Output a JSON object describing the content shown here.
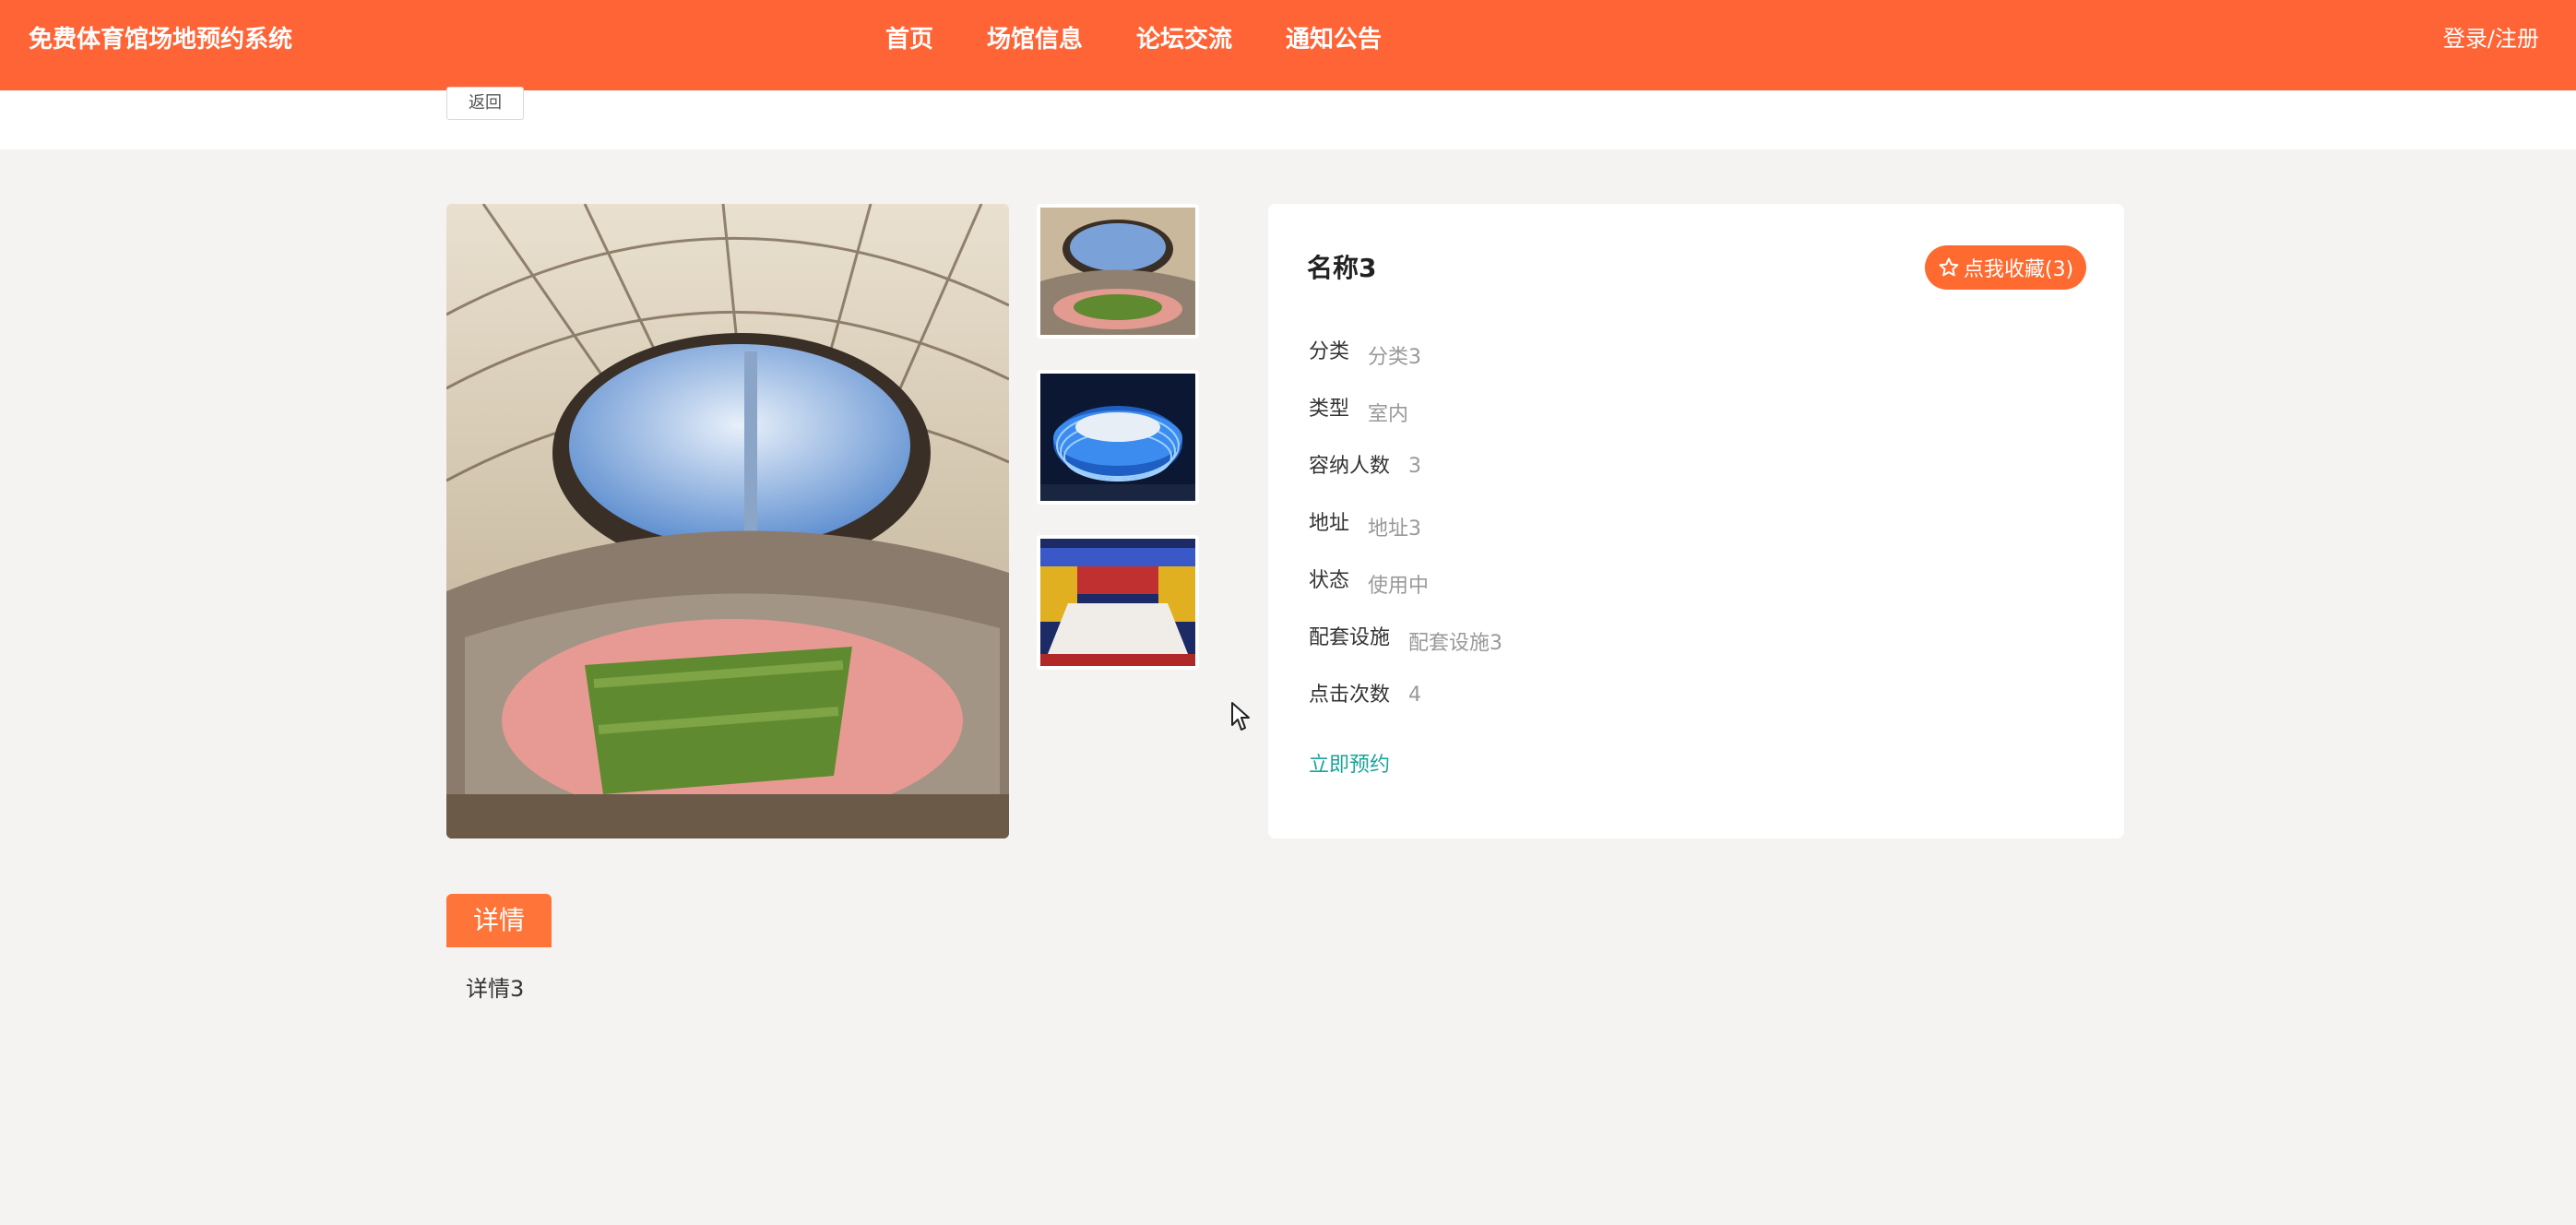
{
  "header": {
    "site_title": "免费体育馆场地预约系统",
    "nav": [
      "首页",
      "场馆信息",
      "论坛交流",
      "通知公告"
    ],
    "login": "登录/注册"
  },
  "back_label": "返回",
  "venue": {
    "name": "名称3",
    "favorite_label": "点我收藏(3)",
    "fields": [
      {
        "label": "分类",
        "value": "分类3"
      },
      {
        "label": "类型",
        "value": "室内"
      },
      {
        "label": "容纳人数",
        "value": "3"
      },
      {
        "label": "地址",
        "value": "地址3"
      },
      {
        "label": "状态",
        "value": "使用中"
      },
      {
        "label": "配套设施",
        "value": "配套设施3"
      },
      {
        "label": "点击次数",
        "value": "4"
      }
    ],
    "book_label": "立即预约"
  },
  "detail": {
    "tab_label": "详情",
    "text": "详情3"
  },
  "colors": {
    "header_bg": "#ff6436",
    "accent": "#ff6a30",
    "link": "#1aa39a"
  }
}
